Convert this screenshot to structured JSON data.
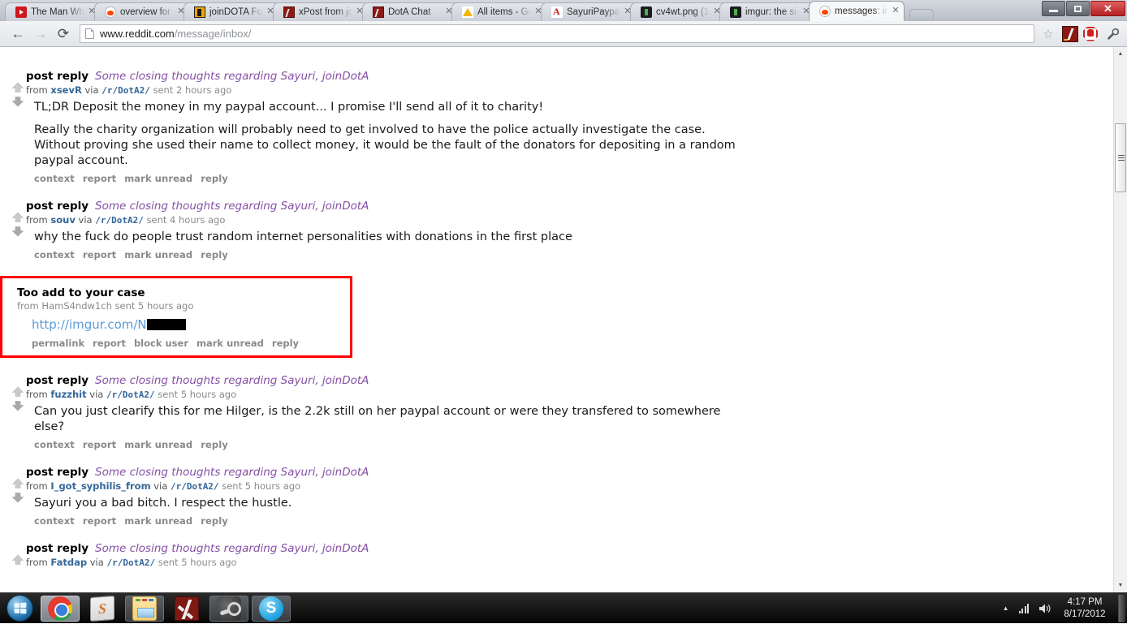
{
  "window": {
    "controls": {
      "minimize": "–",
      "maximize": "❐",
      "close": "✕"
    }
  },
  "tabs": [
    {
      "title": "The Man Wh",
      "favicon": "youtube-icon",
      "active": false
    },
    {
      "title": "overview for",
      "favicon": "reddit-icon",
      "active": false
    },
    {
      "title": "joinDOTA Fo",
      "favicon": "joindota-icon",
      "active": false
    },
    {
      "title": "xPost from jo",
      "favicon": "dota-icon",
      "active": false
    },
    {
      "title": "DotA Chat",
      "favicon": "dota-icon",
      "active": false
    },
    {
      "title": "All items - Go",
      "favicon": "gdrive-icon",
      "active": false
    },
    {
      "title": "SayuriPaypal.",
      "favicon": "pdf-icon",
      "active": false
    },
    {
      "title": "cv4wt.png (1",
      "favicon": "imageviewer-icon",
      "active": false
    },
    {
      "title": "imgur: the si",
      "favicon": "imageviewer-icon",
      "active": false
    },
    {
      "title": "messages: inl",
      "favicon": "reddit-icon",
      "active": true
    }
  ],
  "tab_close_label": "✕",
  "nav": {
    "back": "←",
    "forward": "→",
    "reload": "⟳",
    "star": "☆",
    "extensions": [
      {
        "name": "dota-extension-icon"
      },
      {
        "name": "adblock-icon"
      },
      {
        "name": "wrench-menu-icon",
        "glyph": "🔧"
      }
    ]
  },
  "omnibox": {
    "host": "www.reddit.com",
    "path": "/message/inbox/",
    "page_icon": "document-icon"
  },
  "messages": [
    {
      "kind": "post reply",
      "subject": "Some closing thoughts regarding Sayuri, joinDotA",
      "from_label": "from",
      "author": "xsevR",
      "via_label": "via",
      "subreddit": "/r/DotA2/",
      "time": "sent 2 hours ago",
      "body": [
        "TL;DR Deposit the money in my paypal account... I promise I'll send all of it to charity!",
        "Really the charity organization will probably need to get involved to have the police actually investigate the case. Without proving she used their name to collect money, it would be the fault of the donators for depositing in a random paypal account."
      ],
      "links": [
        "context",
        "report",
        "mark unread",
        "reply"
      ],
      "highlighted": false
    },
    {
      "kind": "post reply",
      "subject": "Some closing thoughts regarding Sayuri, joinDotA",
      "from_label": "from",
      "author": "souv",
      "via_label": "via",
      "subreddit": "/r/DotA2/",
      "time": "sent 4 hours ago",
      "body": [
        "why the fuck do people trust random internet personalities with donations in the first place"
      ],
      "links": [
        "context",
        "report",
        "mark unread",
        "reply"
      ],
      "highlighted": false
    },
    {
      "kind": "Too add to your case",
      "subject": "",
      "from_label": "from",
      "author": "HamS4ndw1ch",
      "via_label": "",
      "subreddit": "",
      "time": "sent 5 hours ago",
      "body_link": "http://imgur.com/N",
      "body_redacted": true,
      "links": [
        "permalink",
        "report",
        "block user",
        "mark unread",
        "reply"
      ],
      "highlighted": true
    },
    {
      "kind": "post reply",
      "subject": "Some closing thoughts regarding Sayuri, joinDotA",
      "from_label": "from",
      "author": "fuzzhit",
      "via_label": "via",
      "subreddit": "/r/DotA2/",
      "time": "sent 5 hours ago",
      "body": [
        "Can you just clearify this for me Hilger, is the 2.2k still on her paypal account or were they transfered to somewhere else?"
      ],
      "links": [
        "context",
        "report",
        "mark unread",
        "reply"
      ],
      "highlighted": false
    },
    {
      "kind": "post reply",
      "subject": "Some closing thoughts regarding Sayuri, joinDotA",
      "from_label": "from",
      "author": "I_got_syphilis_from",
      "via_label": "via",
      "subreddit": "/r/DotA2/",
      "time": "sent 5 hours ago",
      "body": [
        "Sayuri you a bad bitch. I respect the hustle."
      ],
      "links": [
        "context",
        "report",
        "mark unread",
        "reply"
      ],
      "highlighted": false
    },
    {
      "kind": "post reply",
      "subject": "Some closing thoughts regarding Sayuri, joinDotA",
      "from_label": "from",
      "author": "Fatdap",
      "via_label": "via",
      "subreddit": "/r/DotA2/",
      "time": "sent 5 hours ago",
      "body": [],
      "links": [],
      "highlighted": false
    }
  ],
  "scrollbar": {
    "up_arrow": "▲",
    "down_arrow": "▼"
  },
  "taskbar": {
    "start": "start-orb",
    "items": [
      {
        "name": "chrome",
        "icon": "chrome-icon",
        "state": "running"
      },
      {
        "name": "sublime-text",
        "icon": "sublime-icon",
        "state": "pinned"
      },
      {
        "name": "windows-explorer",
        "icon": "explorer-icon",
        "state": "running2"
      },
      {
        "name": "dota-2",
        "icon": "dota2-icon",
        "state": "pinned"
      },
      {
        "name": "steam",
        "icon": "steam-icon",
        "state": "running2"
      },
      {
        "name": "skype",
        "icon": "skype-icon",
        "state": "running2"
      }
    ],
    "tray": {
      "expand": "▲",
      "network": "signal-icon",
      "volume": "🔊",
      "time": "4:17 PM",
      "date": "8/17/2012"
    }
  },
  "colors": {
    "highlight_border": "#ff0000",
    "subject_link": "#8650a6",
    "author_link": "#336699",
    "body_link": "#5b9bd5",
    "meta_gray": "#888a8c"
  }
}
